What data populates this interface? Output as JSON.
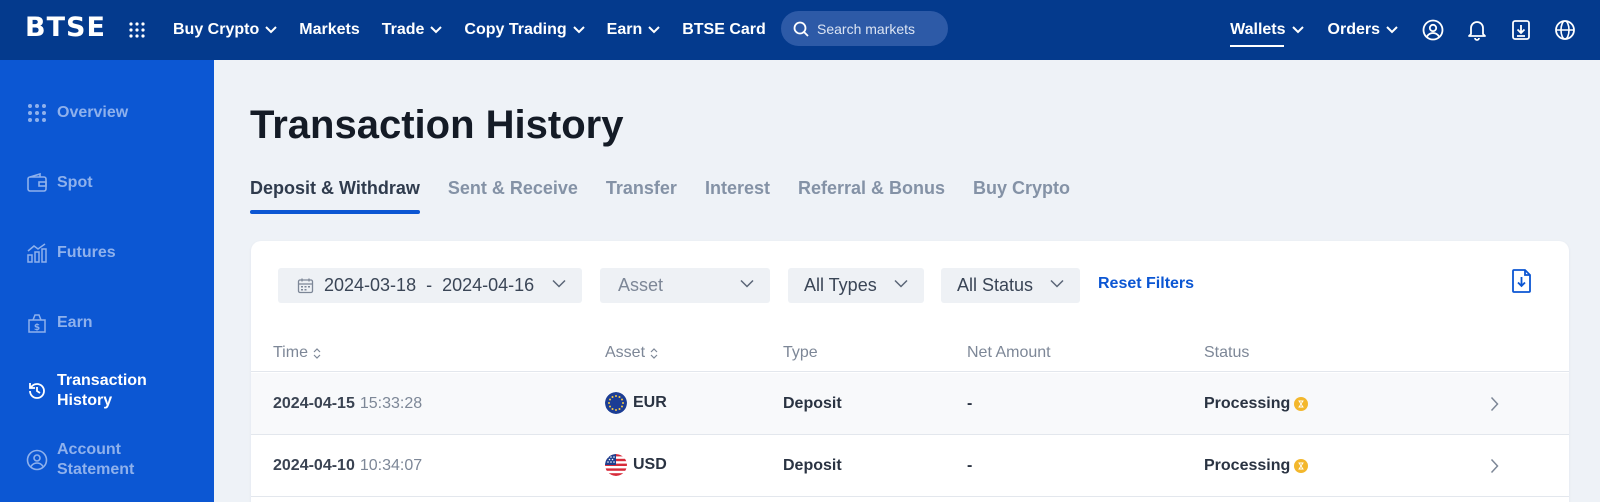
{
  "brand": {
    "logo_text": "BTSE"
  },
  "topnav": {
    "items": [
      {
        "label": "Buy Crypto",
        "has_dropdown": true
      },
      {
        "label": "Markets",
        "has_dropdown": false
      },
      {
        "label": "Trade",
        "has_dropdown": true
      },
      {
        "label": "Copy Trading",
        "has_dropdown": true
      },
      {
        "label": "Earn",
        "has_dropdown": true
      },
      {
        "label": "BTSE Card",
        "has_dropdown": false
      }
    ],
    "search_placeholder": "Search markets",
    "right_items": [
      {
        "label": "Wallets",
        "active": true
      },
      {
        "label": "Orders",
        "active": false
      }
    ],
    "icons": [
      "account-icon",
      "bell-icon",
      "download-app-icon",
      "globe-icon"
    ]
  },
  "sidebar": {
    "items": [
      {
        "label": "Overview",
        "icon": "grid-icon"
      },
      {
        "label": "Spot",
        "icon": "wallet-icon"
      },
      {
        "label": "Futures",
        "icon": "chart-icon"
      },
      {
        "label": "Earn",
        "icon": "money-bag-icon"
      },
      {
        "label_line1": "Transaction",
        "label_line2": "History",
        "icon": "history-icon",
        "active": true
      },
      {
        "label_line1": "Account",
        "label_line2": "Statement",
        "icon": "account-icon"
      }
    ]
  },
  "main": {
    "title": "Transaction History",
    "tabs": [
      {
        "label": "Deposit & Withdraw",
        "active": true
      },
      {
        "label": "Sent & Receive"
      },
      {
        "label": "Transfer"
      },
      {
        "label": "Interest"
      },
      {
        "label": "Referral & Bonus"
      },
      {
        "label": "Buy Crypto"
      }
    ],
    "filters": {
      "date_start": "2024-03-18",
      "date_separator": "-",
      "date_end": "2024-04-16",
      "asset_placeholder": "Asset",
      "type_value": "All Types",
      "status_value": "All Status",
      "reset_label": "Reset Filters"
    },
    "table": {
      "columns": [
        "Time",
        "Asset",
        "Type",
        "Net Amount",
        "Status"
      ],
      "rows": [
        {
          "date": "2024-04-15",
          "time": "15:33:28",
          "asset": "EUR",
          "asset_icon": "eu-flag-icon",
          "type": "Deposit",
          "net_amount": "-",
          "status": "Processing"
        },
        {
          "date": "2024-04-10",
          "time": "10:34:07",
          "asset": "USD",
          "asset_icon": "us-flag-icon",
          "type": "Deposit",
          "net_amount": "-",
          "status": "Processing"
        }
      ]
    }
  },
  "colors": {
    "topbar": "#043a8d",
    "sidebar": "#0c57d3",
    "accent": "#0b56d3",
    "status_processing": "#f3b72c"
  }
}
